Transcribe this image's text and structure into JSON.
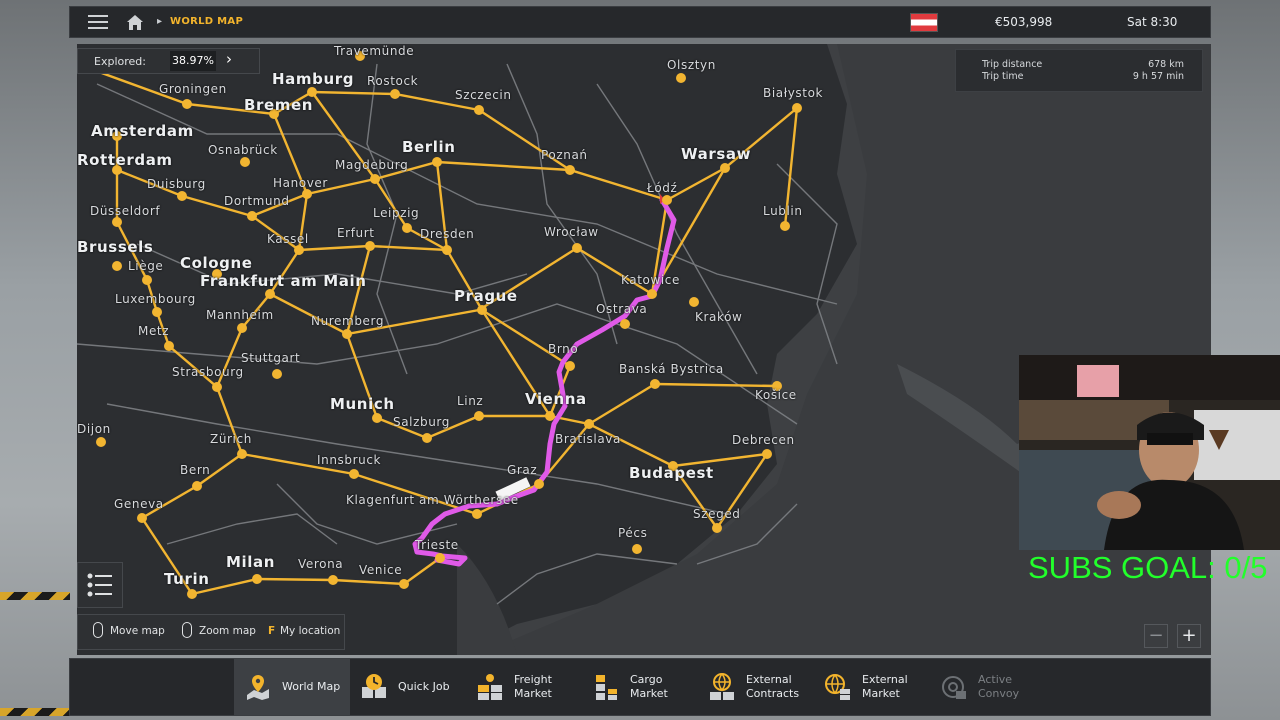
{
  "topbar": {
    "breadcrumb": "WORLD MAP",
    "money": "€503,998",
    "time": "Sat 8:30"
  },
  "explored": {
    "label": "Explored:",
    "value": "38.97%"
  },
  "trip": {
    "distance_label": "Trip distance",
    "distance_value": "678 km",
    "time_label": "Trip time",
    "time_value": "9 h 57 min"
  },
  "cities": [
    {
      "name": "Travemünde"
    },
    {
      "name": "Hamburg",
      "big": true
    },
    {
      "name": "Rostock"
    },
    {
      "name": "Groningen"
    },
    {
      "name": "Bremen",
      "big": true
    },
    {
      "name": "Amsterdam",
      "big": true
    },
    {
      "name": "Szczecin"
    },
    {
      "name": "Olsztyn"
    },
    {
      "name": "Białystok"
    },
    {
      "name": "Berlin",
      "big": true
    },
    {
      "name": "Poznań"
    },
    {
      "name": "Warsaw",
      "big": true
    },
    {
      "name": "Rotterdam",
      "big": true
    },
    {
      "name": "Osnabrück"
    },
    {
      "name": "Magdeburg"
    },
    {
      "name": "Łódź"
    },
    {
      "name": "Hanover"
    },
    {
      "name": "Duisburg"
    },
    {
      "name": "Dortmund"
    },
    {
      "name": "Lublin"
    },
    {
      "name": "Düsseldorf"
    },
    {
      "name": "Leipzig"
    },
    {
      "name": "Kassel"
    },
    {
      "name": "Erfurt"
    },
    {
      "name": "Dresden"
    },
    {
      "name": "Wrocław"
    },
    {
      "name": "Brussels",
      "big": true
    },
    {
      "name": "Liège"
    },
    {
      "name": "Cologne",
      "big": true
    },
    {
      "name": "Frankfurt am Main",
      "big": true
    },
    {
      "name": "Katowice"
    },
    {
      "name": "Prague",
      "big": true
    },
    {
      "name": "Luxembourg"
    },
    {
      "name": "Ostrava"
    },
    {
      "name": "Kraków"
    },
    {
      "name": "Mannheim"
    },
    {
      "name": "Nuremberg"
    },
    {
      "name": "Metz"
    },
    {
      "name": "Brno"
    },
    {
      "name": "Stuttgart"
    },
    {
      "name": "Banská Bystrica"
    },
    {
      "name": "Strasbourg"
    },
    {
      "name": "Košice"
    },
    {
      "name": "Munich",
      "big": true
    },
    {
      "name": "Linz"
    },
    {
      "name": "Vienna",
      "big": true
    },
    {
      "name": "Salzburg"
    },
    {
      "name": "Dijon"
    },
    {
      "name": "Zürich"
    },
    {
      "name": "Bratislava"
    },
    {
      "name": "Debrecen"
    },
    {
      "name": "Innsbruck"
    },
    {
      "name": "Graz"
    },
    {
      "name": "Budapest",
      "big": true
    },
    {
      "name": "Bern"
    },
    {
      "name": "Klagenfurt am Wörthersee"
    },
    {
      "name": "Geneva"
    },
    {
      "name": "Szeged"
    },
    {
      "name": "Pécs"
    },
    {
      "name": "Trieste"
    },
    {
      "name": "Milan",
      "big": true
    },
    {
      "name": "Verona"
    },
    {
      "name": "Venice"
    },
    {
      "name": "Turin",
      "big": true
    }
  ],
  "hints": {
    "move": "Move map",
    "zoom": "Zoom map",
    "key": "F",
    "location": "My location"
  },
  "zoom": {
    "minus": "−",
    "plus": "+"
  },
  "tabs": [
    {
      "label": "World Map",
      "icon": "map-pin-icon"
    },
    {
      "label": "Quick Job",
      "icon": "clock-icon"
    },
    {
      "label": "Freight\nMarket",
      "icon": "crates-icon"
    },
    {
      "label": "Cargo\nMarket",
      "icon": "cargo-icon"
    },
    {
      "label": "External\nContracts",
      "icon": "globe-icon"
    },
    {
      "label": "External\nMarket",
      "icon": "globe-icon"
    },
    {
      "label": "Active\nConvoy",
      "icon": "convoy-icon"
    }
  ],
  "tab_labels": {
    "t0a": "World Map",
    "t1a": "Quick Job",
    "t2a": "Freight",
    "t2b": "Market",
    "t3a": "Cargo",
    "t3b": "Market",
    "t4a": "External",
    "t4b": "Contracts",
    "t5a": "External",
    "t5b": "Market",
    "t6a": "Active",
    "t6b": "Convoy"
  },
  "overlay": {
    "subs_goal": "SUBS GOAL: 0/5"
  },
  "colors": {
    "route": "#e05ae8",
    "highway": "#f2b531",
    "road": "#7d8084",
    "map_bg": "#3e4043"
  }
}
